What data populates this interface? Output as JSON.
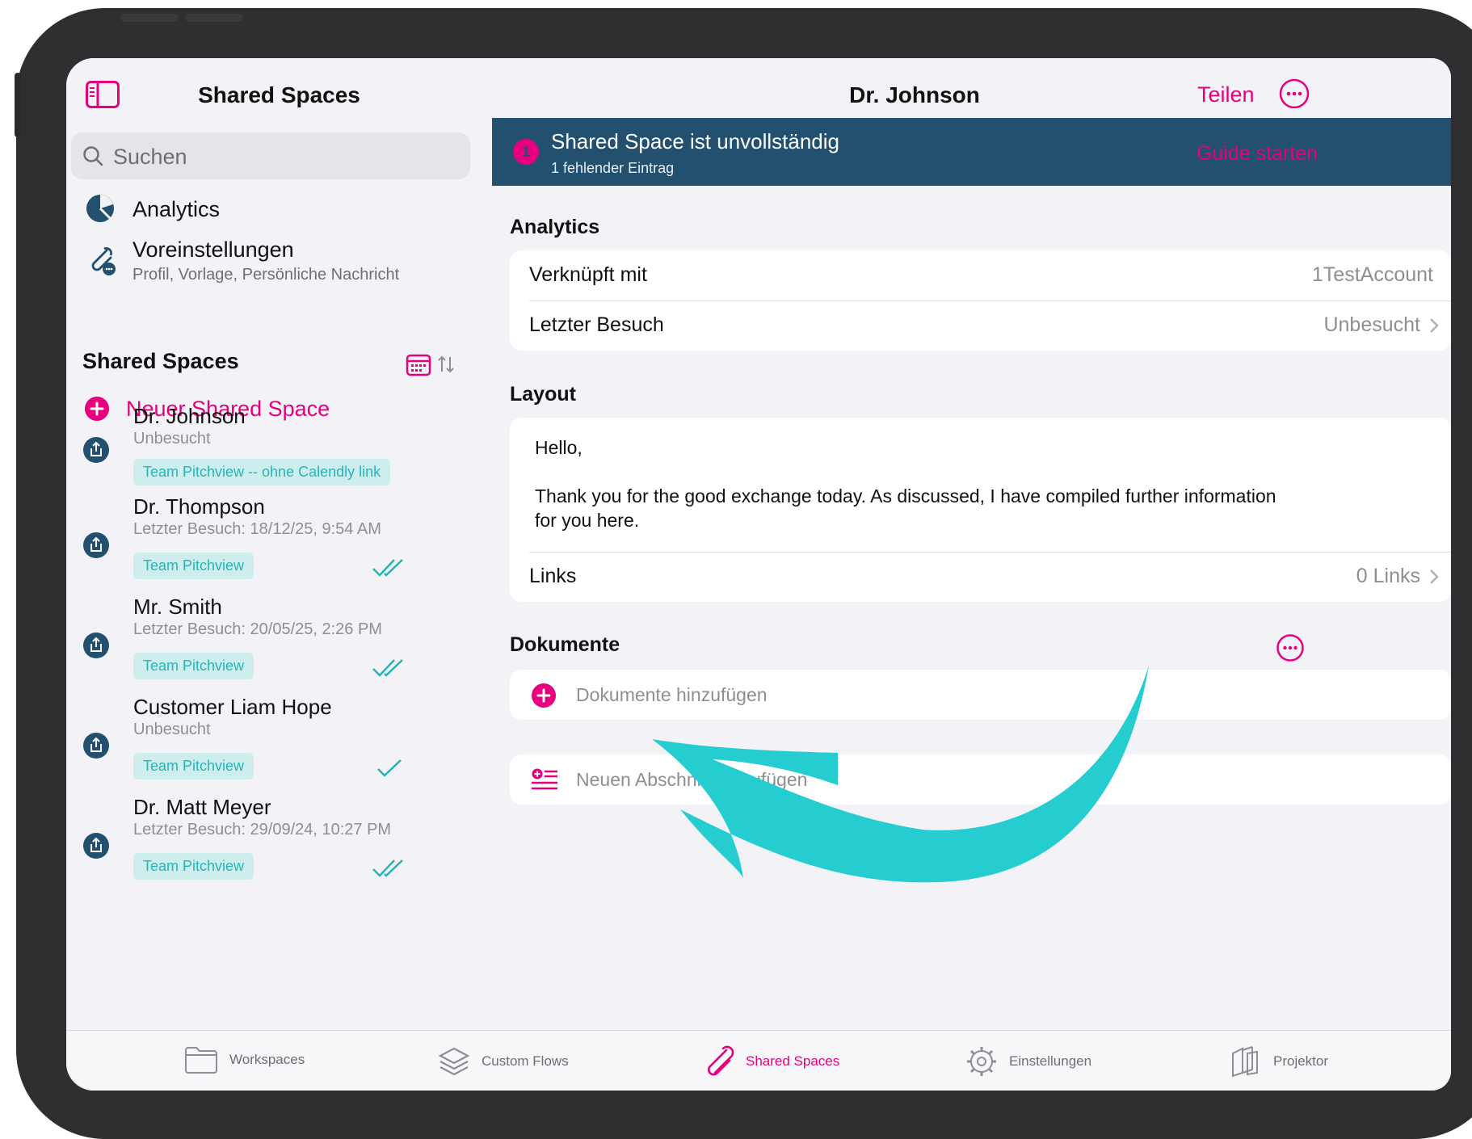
{
  "sidebar": {
    "title": "Shared Spaces",
    "search_placeholder": "Suchen",
    "nav": [
      {
        "label": "Analytics",
        "sub": ""
      },
      {
        "label": "Voreinstellungen",
        "sub": "Profil, Vorlage, Persönliche Nachricht"
      }
    ],
    "section_title": "Shared Spaces",
    "new_space_label": "Neuer Shared Space",
    "spaces": [
      {
        "name": "Dr. Johnson",
        "visit": "Unbesucht",
        "tag": "Team Pitchview -- ohne Calendly link",
        "status": "none"
      },
      {
        "name": "Dr. Thompson",
        "visit": "Letzter Besuch: 18/12/25, 9:54 AM",
        "tag": "Team Pitchview",
        "status": "double-check"
      },
      {
        "name": "Mr. Smith",
        "visit": "Letzter Besuch: 20/05/25, 2:26 PM",
        "tag": "Team Pitchview",
        "status": "double-check"
      },
      {
        "name": "Customer Liam Hope",
        "visit": "Unbesucht",
        "tag": "Team Pitchview",
        "status": "single-check"
      },
      {
        "name": "Dr. Matt Meyer",
        "visit": "Letzter Besuch: 29/09/24, 10:27 PM",
        "tag": "Team Pitchview",
        "status": "double-check"
      }
    ]
  },
  "main": {
    "title": "Dr. Johnson",
    "share_label": "Teilen",
    "banner": {
      "badge": "1",
      "title": "Shared Space ist unvollständig",
      "subtitle": "1 fehlender Eintrag",
      "action": "Guide starten"
    },
    "analytics": {
      "title": "Analytics",
      "rows": [
        {
          "label": "Verknüpft mit",
          "value": "1TestAccount"
        },
        {
          "label": "Letzter Besuch",
          "value": "Unbesucht"
        }
      ]
    },
    "layout": {
      "title": "Layout",
      "message_line1": "Hello,",
      "message_line2": "Thank you for the good exchange today. As discussed, I have compiled further information",
      "message_line3": "for you here.",
      "links_label": "Links",
      "links_value": "0 Links"
    },
    "documents": {
      "title": "Dokumente",
      "add_label": "Dokumente hinzufügen",
      "new_section_label": "Neuen Abschnitt hinzufügen"
    }
  },
  "tabbar": {
    "tabs": [
      {
        "label": "Workspaces"
      },
      {
        "label": "Custom Flows"
      },
      {
        "label": "Shared Spaces"
      },
      {
        "label": "Einstellungen"
      },
      {
        "label": "Projektor"
      }
    ]
  },
  "colors": {
    "accent": "#e6007e",
    "banner": "#22506e",
    "tag_bg": "#cdeeed",
    "tag_text": "#2ab3b6",
    "arrow": "#26cdd0"
  }
}
